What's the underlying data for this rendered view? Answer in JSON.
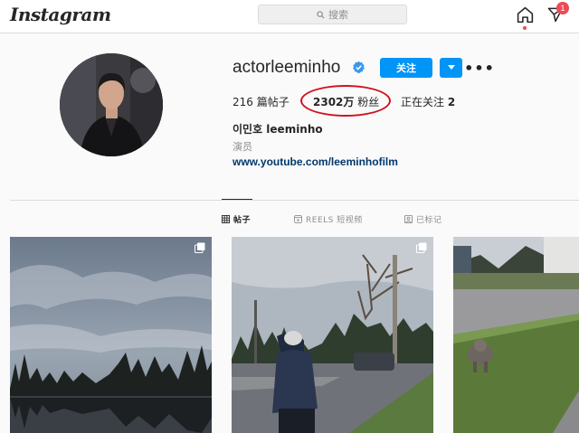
{
  "header": {
    "logo_text": "Instagram",
    "search_placeholder": "搜索",
    "notification_count": "1"
  },
  "profile": {
    "username": "actorleeminho",
    "verified": true,
    "follow_label": "关注",
    "more_label": "•••",
    "stats": {
      "posts_count": "216",
      "posts_label": "篇帖子",
      "followers_count": "2302万",
      "followers_label": "粉丝",
      "following_label": "正在关注",
      "following_count": "2"
    },
    "full_name": "이민호 leeminho",
    "bio": "演员",
    "website": "www.youtube.com/leeminhofilm"
  },
  "tabs": [
    {
      "label": "帖子",
      "active": true,
      "icon": "grid-icon"
    },
    {
      "label": "REELS 短视频",
      "active": false,
      "icon": "reels-icon"
    },
    {
      "label": "已标记",
      "active": false,
      "icon": "tag-icon"
    }
  ],
  "colors": {
    "accent": "#0095f6",
    "highlight_oval": "#d0131f",
    "notification": "#ed4956",
    "link": "#00376b"
  },
  "posts": [
    {
      "description_icon": "lake-photo",
      "multi": true
    },
    {
      "description_icon": "street-photo",
      "multi": true
    },
    {
      "description_icon": "dog-photo",
      "multi": false
    }
  ]
}
